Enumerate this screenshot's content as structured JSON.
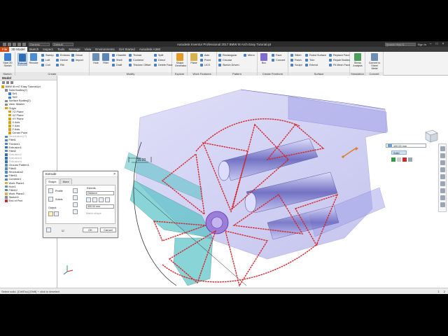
{
  "window": {
    "title": "Autodesk Inventor Professional 2017   BMW I8 Arch Easy Tutorial.ipt",
    "material_combo": "Generic",
    "appearance_combo": "Default",
    "search_placeholder": "Search Help & Commands...",
    "sign_in": "Sign In"
  },
  "tabs": [
    "File",
    "3D Model",
    "Sketch",
    "Inspect",
    "Tools",
    "Manage",
    "View",
    "Environments",
    "Get Started",
    "Autodesk A360"
  ],
  "ribbon": {
    "panels": [
      {
        "label": "Sketch"
      },
      {
        "label": "Create"
      },
      {
        "label": "Modify"
      },
      {
        "label": "Explore"
      },
      {
        "label": "Work Features"
      },
      {
        "label": "Pattern"
      },
      {
        "label": "Create Freeform"
      },
      {
        "label": "Surface"
      },
      {
        "label": "Simulation"
      },
      {
        "label": "Convert"
      }
    ],
    "big_buttons": [
      {
        "label": "Start 2D Sketch",
        "color": "#3d7fd1"
      },
      {
        "label": "Extrude",
        "color": "#2f6db5"
      },
      {
        "label": "Revolve",
        "color": "#4a8cd6"
      },
      {
        "label": "Hole",
        "color": "#6b8fb5"
      },
      {
        "label": "Fillet",
        "color": "#5a86b8"
      },
      {
        "label": "Shape Generator",
        "color": "#e39a2b"
      },
      {
        "label": "Plane",
        "color": "#d6b24a"
      },
      {
        "label": "Box",
        "color": "#7f6bd1"
      },
      {
        "label": "Stress Analysis",
        "color": "#4c9e5a"
      },
      {
        "label": "Convert to Sheet Metal",
        "color": "#6d8fb2"
      }
    ],
    "small_buttons": [
      {
        "label": "Sweep",
        "color": "#4a7fc0"
      },
      {
        "label": "Loft",
        "color": "#4a7fc0"
      },
      {
        "label": "Coil",
        "color": "#4a7fc0"
      },
      {
        "label": "Emboss",
        "color": "#4a7fc0"
      },
      {
        "label": "Derive",
        "color": "#4a7fc0"
      },
      {
        "label": "Rib",
        "color": "#4a7fc0"
      },
      {
        "label": "Decal",
        "color": "#4a7fc0"
      },
      {
        "label": "Import",
        "color": "#4a7fc0"
      },
      {
        "label": "Chamfer",
        "color": "#5a86b8"
      },
      {
        "label": "Shell",
        "color": "#5a86b8"
      },
      {
        "label": "Draft",
        "color": "#5a86b8"
      },
      {
        "label": "Thread",
        "color": "#5a86b8"
      },
      {
        "label": "Combine",
        "color": "#5a86b8"
      },
      {
        "label": "Thicken/ Offset",
        "color": "#5a86b8"
      },
      {
        "label": "Split",
        "color": "#5a86b8"
      },
      {
        "label": "Direct",
        "color": "#5a86b8"
      },
      {
        "label": "Delete Face",
        "color": "#5a86b8"
      },
      {
        "label": "Axis",
        "color": "#d6b24a"
      },
      {
        "label": "Point",
        "color": "#d6b24a"
      },
      {
        "label": "UCS",
        "color": "#d6b24a"
      },
      {
        "label": "Rectangular",
        "color": "#5b8ac4"
      },
      {
        "label": "Circular",
        "color": "#5b8ac4"
      },
      {
        "label": "Sketch Driven",
        "color": "#5b8ac4"
      },
      {
        "label": "Mirror",
        "color": "#5b8ac4"
      },
      {
        "label": "Face",
        "color": "#7f6bd1"
      },
      {
        "label": "Convert",
        "color": "#7f6bd1"
      },
      {
        "label": "Stitch",
        "color": "#c4892e"
      },
      {
        "label": "Patch",
        "color": "#c4892e"
      },
      {
        "label": "Sculpt",
        "color": "#c4892e"
      },
      {
        "label": "Ruled Surface",
        "color": "#c4892e"
      },
      {
        "label": "Trim",
        "color": "#c4892e"
      },
      {
        "label": "Extend",
        "color": "#c4892e"
      },
      {
        "label": "Replace Face",
        "color": "#c4892e"
      },
      {
        "label": "Repair Bodies",
        "color": "#c4892e"
      },
      {
        "label": "Fit Mesh Face",
        "color": "#c4892e"
      }
    ]
  },
  "browser": {
    "title": "Model",
    "items": [
      {
        "label": "BMW i8 rm7 Easy Tutorial.ipt",
        "dim": false,
        "indent": 0,
        "color": "#d4a017"
      },
      {
        "label": "Solid Bodies(2)",
        "dim": false,
        "indent": 1,
        "color": "#8a8a8a"
      },
      {
        "label": "Srf1",
        "dim": false,
        "indent": 2,
        "color": "#3d7fd1"
      },
      {
        "label": "Srf2",
        "dim": false,
        "indent": 2,
        "color": "#3d7fd1"
      },
      {
        "label": "Surface Bodies(2)",
        "dim": false,
        "indent": 1,
        "color": "#8a8a8a"
      },
      {
        "label": "View: Master",
        "dim": false,
        "indent": 1,
        "color": "#8a8a8a"
      },
      {
        "label": "Origin",
        "dim": false,
        "indent": 1,
        "color": "#d4a017"
      },
      {
        "label": "YZ Plane",
        "dim": false,
        "indent": 2,
        "color": "#d4a017"
      },
      {
        "label": "XZ Plane",
        "dim": false,
        "indent": 2,
        "color": "#d4a017"
      },
      {
        "label": "XY Plane",
        "dim": false,
        "indent": 2,
        "color": "#d4a017"
      },
      {
        "label": "X Axis",
        "dim": false,
        "indent": 2,
        "color": "#d4a017"
      },
      {
        "label": "Y Axis",
        "dim": false,
        "indent": 2,
        "color": "#d4a017"
      },
      {
        "label": "Z Axis",
        "dim": false,
        "indent": 2,
        "color": "#d4a017"
      },
      {
        "label": "Center Point",
        "dim": false,
        "indent": 2,
        "color": "#d4a017"
      },
      {
        "label": "Revolution1(Y)",
        "dim": true,
        "indent": 1,
        "color": "#4a8cd6"
      },
      {
        "label": "Fillet1",
        "dim": false,
        "indent": 1,
        "color": "#5a86b8"
      },
      {
        "label": "Thicken1",
        "dim": false,
        "indent": 1,
        "color": "#5a86b8"
      },
      {
        "label": "Extrusion1",
        "dim": false,
        "indent": 1,
        "color": "#2f6db5"
      },
      {
        "label": "Fillet2",
        "dim": false,
        "indent": 1,
        "color": "#5a86b8"
      },
      {
        "label": "Extrusion2",
        "dim": true,
        "indent": 1,
        "color": "#2f6db5"
      },
      {
        "label": "Extrusion3",
        "dim": true,
        "indent": 1,
        "color": "#2f6db5"
      },
      {
        "label": "Extrusion4",
        "dim": true,
        "indent": 1,
        "color": "#2f6db5"
      },
      {
        "label": "Circular Pattern1",
        "dim": false,
        "indent": 1,
        "color": "#5b8ac4"
      },
      {
        "label": "Fillet3",
        "dim": false,
        "indent": 1,
        "color": "#5a86b8"
      },
      {
        "label": "Revolution2",
        "dim": false,
        "indent": 1,
        "color": "#4a8cd6"
      },
      {
        "label": "Fillet11",
        "dim": false,
        "indent": 1,
        "color": "#5a86b8"
      },
      {
        "label": "Combine1",
        "dim": false,
        "indent": 1,
        "color": "#5a86b8"
      },
      {
        "label": "Work Plane1",
        "dim": false,
        "indent": 1,
        "color": "#d6b24a"
      },
      {
        "label": "Hole1",
        "dim": false,
        "indent": 1,
        "color": "#6b8fb5"
      },
      {
        "label": "Fillet12",
        "dim": false,
        "indent": 1,
        "color": "#5a86b8"
      },
      {
        "label": "Work Plane2",
        "dim": false,
        "indent": 1,
        "color": "#d6b24a"
      },
      {
        "label": "Sketch9",
        "dim": false,
        "indent": 1,
        "color": "#8a8a8a"
      },
      {
        "label": "End of Part",
        "dim": false,
        "indent": 1,
        "color": "#c23030"
      }
    ]
  },
  "dialog": {
    "title": "Extrude",
    "tab_shape": "Shape",
    "tab_more": "More",
    "profile_label": "Profile",
    "solids_label": "Solids",
    "output_label": "Output",
    "extents_label": "Extents",
    "extents_value": "Distance",
    "distance_value": "300.00 mm",
    "match_shape_label": "Match shape",
    "ok_label": "OK",
    "cancel_label": "Cancel"
  },
  "minitool": {
    "distance_value": "100.00 mm",
    "mode_value": "Solid"
  },
  "viewport": {
    "dimension_label": "15.00",
    "accent_red": "#d3262b",
    "body_blue": "#8c8ce6",
    "surface_teal": "#56c2c6"
  },
  "status": {
    "message": "Select solid. [Ctrl/Esc] [Shift] + click to deselect",
    "right": [
      "1",
      "2"
    ]
  }
}
